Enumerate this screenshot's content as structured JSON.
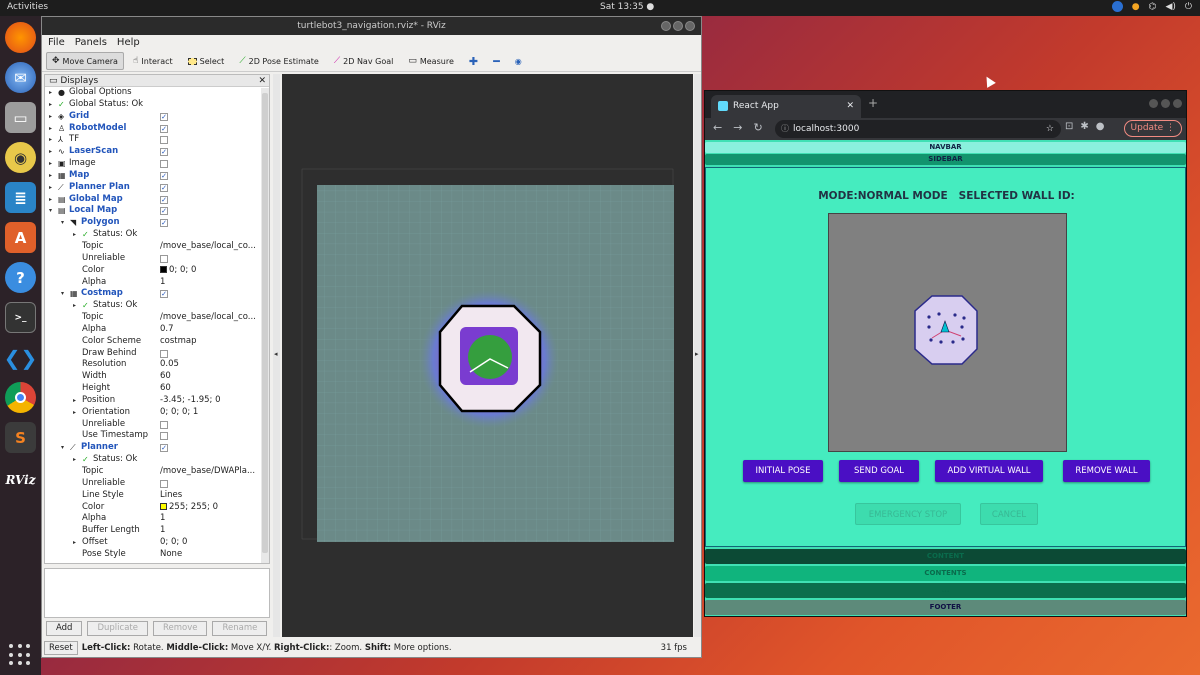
{
  "topbar": {
    "activities": "Activities",
    "clock": "Sat 13:35 ●"
  },
  "dock": {
    "items": [
      "firefox-icon",
      "thunderbird-icon",
      "files-icon",
      "rhythmbox-icon",
      "libreoffice-icon",
      "software-icon",
      "help-icon",
      "terminal-icon",
      "vscode-icon",
      "chrome-icon",
      "sublime-icon",
      "rviz-icon"
    ],
    "rviz_label": "RViz"
  },
  "rviz": {
    "title": "turtlebot3_navigation.rviz* - RViz",
    "menu": [
      "File",
      "Panels",
      "Help"
    ],
    "tools": [
      "Move Camera",
      "Interact",
      "Select",
      "2D Pose Estimate",
      "2D Nav Goal",
      "Measure"
    ],
    "panel_title": "Displays",
    "buttons": {
      "add": "Add",
      "duplicate": "Duplicate",
      "remove": "Remove",
      "rename": "Rename"
    },
    "status": {
      "reset": "Reset",
      "l1": "Left-Click:",
      "l1t": " Rotate. ",
      "l2": "Middle-Click:",
      "l2t": " Move X/Y. ",
      "l3": "Right-Click:",
      "l3t": ": Zoom. ",
      "l4": "Shift:",
      "l4t": " More options.",
      "fps": "31 fps"
    },
    "tree": [
      {
        "name": "Global Options",
        "lvl": 0,
        "arrow": "▸",
        "icon": "●",
        "blue": false
      },
      {
        "name": "Global Status: Ok",
        "lvl": 0,
        "arrow": "▸",
        "icon": "✓",
        "blue": false
      },
      {
        "name": "Grid",
        "lvl": 0,
        "arrow": "▸",
        "icon": "◈",
        "blue": true,
        "check": true
      },
      {
        "name": "RobotModel",
        "lvl": 0,
        "arrow": "▸",
        "icon": "♙",
        "blue": true,
        "check": true
      },
      {
        "name": "TF",
        "lvl": 0,
        "arrow": "▸",
        "icon": "⅄",
        "blue": false,
        "check": false
      },
      {
        "name": "LaserScan",
        "lvl": 0,
        "arrow": "▸",
        "icon": "∿",
        "blue": true,
        "check": true
      },
      {
        "name": "Image",
        "lvl": 0,
        "arrow": "▸",
        "icon": "▣",
        "blue": false,
        "check": false
      },
      {
        "name": "Map",
        "lvl": 0,
        "arrow": "▸",
        "icon": "▦",
        "blue": true,
        "check": true
      },
      {
        "name": "Planner Plan",
        "lvl": 0,
        "arrow": "▸",
        "icon": "⟋",
        "blue": true,
        "check": true
      },
      {
        "name": "Global Map",
        "lvl": 0,
        "arrow": "▸",
        "icon": "▤",
        "blue": true,
        "check": true
      },
      {
        "name": "Local Map",
        "lvl": 0,
        "arrow": "▾",
        "icon": "▤",
        "blue": true,
        "check": true
      },
      {
        "name": "Polygon",
        "lvl": 1,
        "arrow": "▾",
        "icon": "◥",
        "blue": true,
        "check": true
      },
      {
        "name": "Status: Ok",
        "lvl": 2,
        "arrow": "▸",
        "icon": "✓",
        "blue": false
      },
      {
        "name": "Topic",
        "lvl": 2,
        "value": "/move_base/local_co..."
      },
      {
        "name": "Unreliable",
        "lvl": 2,
        "check": false
      },
      {
        "name": "Color",
        "lvl": 2,
        "value": "0; 0; 0",
        "swatch": "#000000"
      },
      {
        "name": "Alpha",
        "lvl": 2,
        "value": "1"
      },
      {
        "name": "Costmap",
        "lvl": 1,
        "arrow": "▾",
        "icon": "▦",
        "blue": true,
        "check": true
      },
      {
        "name": "Status: Ok",
        "lvl": 2,
        "arrow": "▸",
        "icon": "✓",
        "blue": false
      },
      {
        "name": "Topic",
        "lvl": 2,
        "value": "/move_base/local_co..."
      },
      {
        "name": "Alpha",
        "lvl": 2,
        "value": "0.7"
      },
      {
        "name": "Color Scheme",
        "lvl": 2,
        "value": "costmap"
      },
      {
        "name": "Draw Behind",
        "lvl": 2,
        "check": false
      },
      {
        "name": "Resolution",
        "lvl": 2,
        "value": "0.05"
      },
      {
        "name": "Width",
        "lvl": 2,
        "value": "60"
      },
      {
        "name": "Height",
        "lvl": 2,
        "value": "60"
      },
      {
        "name": "Position",
        "lvl": 2,
        "arrow": "▸",
        "value": "-3.45; -1.95; 0"
      },
      {
        "name": "Orientation",
        "lvl": 2,
        "arrow": "▸",
        "value": "0; 0; 0; 1"
      },
      {
        "name": "Unreliable",
        "lvl": 2,
        "check": false
      },
      {
        "name": "Use Timestamp",
        "lvl": 2,
        "check": false
      },
      {
        "name": "Planner",
        "lvl": 1,
        "arrow": "▾",
        "icon": "⟋",
        "blue": true,
        "check": true
      },
      {
        "name": "Status: Ok",
        "lvl": 2,
        "arrow": "▸",
        "icon": "✓",
        "blue": false
      },
      {
        "name": "Topic",
        "lvl": 2,
        "value": "/move_base/DWAPla..."
      },
      {
        "name": "Unreliable",
        "lvl": 2,
        "check": false
      },
      {
        "name": "Line Style",
        "lvl": 2,
        "value": "Lines"
      },
      {
        "name": "Color",
        "lvl": 2,
        "value": "255; 255; 0",
        "swatch": "#ffff00"
      },
      {
        "name": "Alpha",
        "lvl": 2,
        "value": "1"
      },
      {
        "name": "Buffer Length",
        "lvl": 2,
        "value": "1"
      },
      {
        "name": "Offset",
        "lvl": 2,
        "arrow": "▸",
        "value": "0; 0; 0"
      },
      {
        "name": "Pose Style",
        "lvl": 2,
        "value": "None"
      }
    ]
  },
  "chrome": {
    "tab_title": "React App",
    "url": "localhost:3000",
    "update": "Update ⋮",
    "navbar": "NAVBAR",
    "sidebar": "SIDEBAR",
    "mode_text": "MODE:NORMAL MODE   SELECTED WALL ID:",
    "buttons": {
      "initial_pose": "INITIAL POSE",
      "send_goal": "SEND GOAL",
      "add_wall": "ADD VIRTUAL WALL",
      "remove_wall": "REMOVE WALL",
      "emergency": "EMERGENCY STOP",
      "cancel": "CANCEL"
    },
    "lower": {
      "b1": "CONTENT",
      "b2": "CONTENTS",
      "b3": "...",
      "footer": "FOOTER"
    }
  }
}
